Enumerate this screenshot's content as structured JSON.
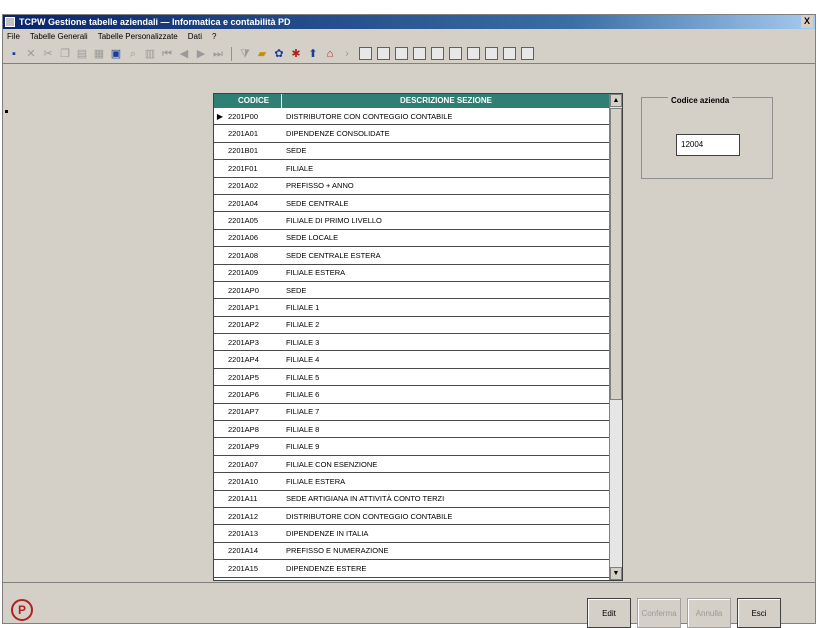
{
  "window": {
    "title": "TCPW Gestione tabelle aziendali — Informatica e contabilità PD",
    "close_glyph": "X"
  },
  "menu": [
    "File",
    "Tabelle Generali",
    "Tabelle Personalizzate",
    "Dati",
    "?"
  ],
  "grid": {
    "columns": {
      "code": "CODICE",
      "desc": "DESCRIZIONE SEZIONE"
    },
    "rows": [
      {
        "selected": true,
        "code": "2201P00",
        "desc": "DISTRIBUTORE CON CONTEGGIO CONTABILE"
      },
      {
        "selected": false,
        "code": "2201A01",
        "desc": "DIPENDENZE CONSOLIDATE"
      },
      {
        "selected": false,
        "code": "2201B01",
        "desc": "SEDE"
      },
      {
        "selected": false,
        "code": "2201F01",
        "desc": "FILIALE"
      },
      {
        "selected": false,
        "code": "2201A02",
        "desc": "PREFISSO + ANNO"
      },
      {
        "selected": false,
        "code": "2201A04",
        "desc": "SEDE CENTRALE"
      },
      {
        "selected": false,
        "code": "2201A05",
        "desc": "FILIALE DI PRIMO LIVELLO"
      },
      {
        "selected": false,
        "code": "2201A06",
        "desc": "SEDE LOCALE"
      },
      {
        "selected": false,
        "code": "2201A08",
        "desc": "SEDE CENTRALE ESTERA"
      },
      {
        "selected": false,
        "code": "2201A09",
        "desc": "FILIALE ESTERA"
      },
      {
        "selected": false,
        "code": "2201AP0",
        "desc": "SEDE"
      },
      {
        "selected": false,
        "code": "2201AP1",
        "desc": "FILIALE 1"
      },
      {
        "selected": false,
        "code": "2201AP2",
        "desc": "FILIALE 2"
      },
      {
        "selected": false,
        "code": "2201AP3",
        "desc": "FILIALE 3"
      },
      {
        "selected": false,
        "code": "2201AP4",
        "desc": "FILIALE 4"
      },
      {
        "selected": false,
        "code": "2201AP5",
        "desc": "FILIALE 5"
      },
      {
        "selected": false,
        "code": "2201AP6",
        "desc": "FILIALE 6"
      },
      {
        "selected": false,
        "code": "2201AP7",
        "desc": "FILIALE 7"
      },
      {
        "selected": false,
        "code": "2201AP8",
        "desc": "FILIALE 8"
      },
      {
        "selected": false,
        "code": "2201AP9",
        "desc": "FILIALE 9"
      },
      {
        "selected": false,
        "code": "2201A07",
        "desc": "FILIALE CON ESENZIONE"
      },
      {
        "selected": false,
        "code": "2201A10",
        "desc": "FILIALE ESTERA"
      },
      {
        "selected": false,
        "code": "2201A11",
        "desc": "SEDE ARTIGIANA IN ATTIVITÀ CONTO TERZI"
      },
      {
        "selected": false,
        "code": "2201A12",
        "desc": "DISTRIBUTORE CON CONTEGGIO CONTABILE"
      },
      {
        "selected": false,
        "code": "2201A13",
        "desc": "DIPENDENZE IN ITALIA"
      },
      {
        "selected": false,
        "code": "2201A14",
        "desc": "PREFISSO E NUMERAZIONE"
      },
      {
        "selected": false,
        "code": "2201A15",
        "desc": "DIPENDENZE ESTERE"
      }
    ]
  },
  "company": {
    "legend": "Codice azienda",
    "value": "12004"
  },
  "buttons": {
    "edit": "Edit",
    "conferma": "Conferma",
    "annulla": "Annulla",
    "esci": "Esci"
  },
  "icons": {
    "logo": "P"
  }
}
